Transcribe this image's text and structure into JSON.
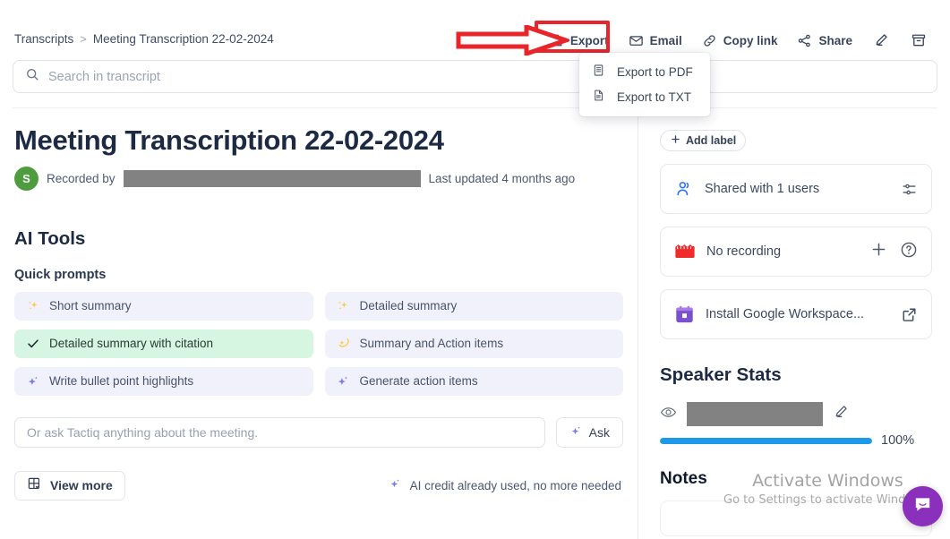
{
  "breadcrumb": {
    "root": "Transcripts",
    "separator": ">",
    "current": "Meeting Transcription 22-02-2024"
  },
  "toolbar": {
    "export": "Export",
    "email": "Email",
    "copy_link": "Copy link",
    "share": "Share",
    "edit_icon": "pencil-icon",
    "archive_icon": "archive-icon"
  },
  "export_menu": {
    "items": [
      {
        "label": "Export to PDF",
        "icon": "pdf-document-icon"
      },
      {
        "label": "Export to TXT",
        "icon": "txt-document-icon"
      }
    ]
  },
  "search": {
    "placeholder": "Search in transcript",
    "value": "",
    "icon": "search-icon"
  },
  "header": {
    "title": "Meeting Transcription 22-02-2024",
    "avatar_initial": "S",
    "recorded_by_label": "Recorded by",
    "recorded_by_value": "",
    "last_updated": "Last updated 4 months ago"
  },
  "ai_tools": {
    "section_title": "AI Tools",
    "quick_prompts_label": "Quick prompts",
    "prompts": [
      {
        "label": "Short summary",
        "icon": "sparkles-yellow-icon",
        "selected": false
      },
      {
        "label": "Detailed summary",
        "icon": "sparkles-yellow-icon",
        "selected": false
      },
      {
        "label": "Detailed summary with citation",
        "icon": "check-icon",
        "selected": true
      },
      {
        "label": "Summary and Action items",
        "icon": "comet-yellow-icon",
        "selected": false
      },
      {
        "label": "Write bullet point highlights",
        "icon": "sparkle-purple-icon",
        "selected": false
      },
      {
        "label": "Generate action items",
        "icon": "sparkle-purple-icon",
        "selected": false
      }
    ],
    "ask_placeholder": "Or ask Tactiq anything about the meeting.",
    "ask_value": "",
    "ask_button": "Ask",
    "view_more": "View more",
    "credit_note": "AI credit already used, no more needed"
  },
  "sidebar": {
    "add_label": "Add label",
    "cards": [
      {
        "label": "Shared with 1 users",
        "icon": "people-icon",
        "action_icon": "sliders-icon"
      },
      {
        "label": "No recording",
        "icon": "clapperboard-red-icon",
        "action_icon": "plus-icon",
        "action_icon2": "help-circle-icon"
      },
      {
        "label": "Install Google Workspace...",
        "icon": "google-calendar-purple-icon",
        "action_icon": "external-link-icon"
      }
    ],
    "speaker_stats": {
      "title": "Speaker Stats",
      "speaker_name": "",
      "percent_label": "100%",
      "percent_value": 100,
      "bar_color": "#1c9ae8"
    },
    "notes_title": "Notes"
  },
  "watermark": {
    "line1": "Activate Windows",
    "line2": "Go to Settings to activate Windows."
  },
  "chat_widget": {
    "icon": "chat-bubble-icon"
  },
  "annotations": {
    "arrow": "red-arrow-pointing-right",
    "highlight_box": "red-box-around-export",
    "color": "#e8252a"
  }
}
